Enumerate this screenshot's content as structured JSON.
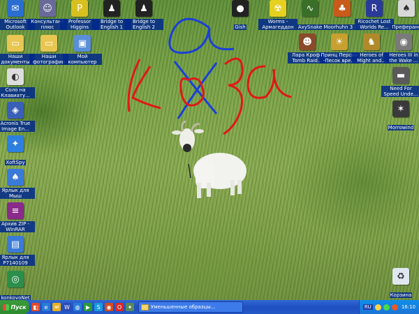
{
  "desktop": {
    "icons_left": [
      {
        "label": "Microsoft Outlook",
        "icon": "outlook-icon",
        "color": "#2a6fd0",
        "glyph": "✉"
      },
      {
        "label": "Консультант плюс",
        "icon": "consultant-icon",
        "color": "#6a6a9a",
        "glyph": "☺"
      },
      {
        "label": "Professor Higgins",
        "icon": "higgins-icon",
        "color": "#d8c020",
        "glyph": "P"
      },
      {
        "label": "Bridge to English 1",
        "icon": "bridge1-icon",
        "color": "#222222",
        "glyph": "♟"
      },
      {
        "label": "Bridge to English 2",
        "icon": "bridge2-icon",
        "color": "#222222",
        "glyph": "♟"
      }
    ],
    "icons_col": [
      {
        "label": "Наши документы",
        "icon": "folder-icon",
        "color": "#e8c652",
        "glyph": "▭"
      },
      {
        "label": "Наши фотографии",
        "icon": "folder-icon",
        "color": "#e8c652",
        "glyph": "▭"
      },
      {
        "label": "Мой компьютер",
        "icon": "computer-icon",
        "color": "#5a8fd8",
        "glyph": "▣"
      },
      {
        "label": "Соло на Клавиату...",
        "icon": "solo-keyboard-icon",
        "color": "#dddddd",
        "glyph": "◐"
      },
      {
        "label": "Acronis True Image En...",
        "icon": "acronis-icon",
        "color": "#3a5fb8",
        "glyph": "◈"
      },
      {
        "label": "XoftSpy",
        "icon": "xoftspy-icon",
        "color": "#2d7fe0",
        "glyph": "✦"
      },
      {
        "label": "Ярлык для Мыш",
        "icon": "mouse-shortcut-icon",
        "color": "#3a7ad8",
        "glyph": "♠"
      },
      {
        "label": "Архив ZIP - WinRAR",
        "icon": "winrar-icon",
        "color": "#8a2a8a",
        "glyph": "≡"
      },
      {
        "label": "Ярлык для P7140109",
        "icon": "image-shortcut-icon",
        "color": "#3a7ad8",
        "glyph": "▤"
      },
      {
        "label": "konkovoNet",
        "icon": "network-icon",
        "color": "#2a8f4a",
        "glyph": "◎"
      }
    ],
    "icons_right_top": [
      {
        "label": "Gish",
        "icon": "gish-icon",
        "color": "#222222",
        "glyph": "●"
      },
      {
        "label": "Worms - Армагеддон",
        "icon": "worms-icon",
        "color": "#e6d020",
        "glyph": "☢"
      },
      {
        "label": "AxySnake",
        "icon": "axysnake-icon",
        "color": "#3a6f2a",
        "glyph": "∿"
      },
      {
        "label": "Moorhuhn 3 DL",
        "icon": "moorhuhn-icon",
        "color": "#c85a1a",
        "glyph": "♣"
      },
      {
        "label": "Ricochet Lost Worlds Re...",
        "icon": "ricochet-icon",
        "color": "#2a3a9a",
        "glyph": "R"
      },
      {
        "label": "Преферанс",
        "icon": "preferans-icon",
        "color": "#d8d8d8",
        "glyph": "♠"
      }
    ],
    "icons_right_second": [
      {
        "label": "Лара Крофт Tomb Raid...",
        "icon": "tombraider-icon",
        "color": "#8a4a2a",
        "glyph": "☻"
      },
      {
        "label": "Принц Персии -Песок вре...",
        "icon": "prince-persia-icon",
        "color": "#c8a030",
        "glyph": "☀"
      },
      {
        "label": "Heroes of Might and...",
        "icon": "heroes-icon",
        "color": "#b08a2a",
        "glyph": "♞"
      },
      {
        "label": "Heroes III in the Wake ...",
        "icon": "heroes3-icon",
        "color": "#7a7a7a",
        "glyph": "◉"
      }
    ],
    "icons_right_col": [
      {
        "label": "Need For Speed Unde...",
        "icon": "nfs-icon",
        "color": "#5a5a5a",
        "glyph": "▬"
      },
      {
        "label": "Morrowind",
        "icon": "morrowind-icon",
        "color": "#3a3a3a",
        "glyph": "✶"
      },
      {
        "label": "Корзина",
        "icon": "recycle-bin-icon",
        "color": "#dfe8ef",
        "glyph": "♻"
      }
    ]
  },
  "taskbar": {
    "start_label": "Пуск",
    "quick_launch": [
      {
        "icon": "show-desktop-icon",
        "color": "#e04a2a",
        "glyph": "◧"
      },
      {
        "icon": "ie-icon",
        "color": "#2a7ad8",
        "glyph": "e"
      },
      {
        "icon": "outlook-ql-icon",
        "color": "#e8b020",
        "glyph": "✉"
      },
      {
        "icon": "word-icon",
        "color": "#2a4ab8",
        "glyph": "W"
      },
      {
        "icon": "firefox-icon",
        "color": "#2a7ad8",
        "glyph": "◍"
      },
      {
        "icon": "media-icon",
        "color": "#2a9a3a",
        "glyph": "▶"
      },
      {
        "icon": "skype-icon",
        "color": "#1a9ae0",
        "glyph": "S"
      },
      {
        "icon": "search-ql-icon",
        "color": "#d84a1a",
        "glyph": "◉"
      },
      {
        "icon": "opera-icon",
        "color": "#d82a2a",
        "glyph": "O"
      },
      {
        "icon": "settings-ql-icon",
        "color": "#5a8a5a",
        "glyph": "✦"
      }
    ],
    "active_task": "Уменьшенные образцы...",
    "tray": {
      "lang": "RU",
      "clock": "16:10"
    }
  },
  "doodle": {
    "top_text": "a",
    "main_text": "коза",
    "blue": "#1a3fd8",
    "red": "#e01818"
  }
}
